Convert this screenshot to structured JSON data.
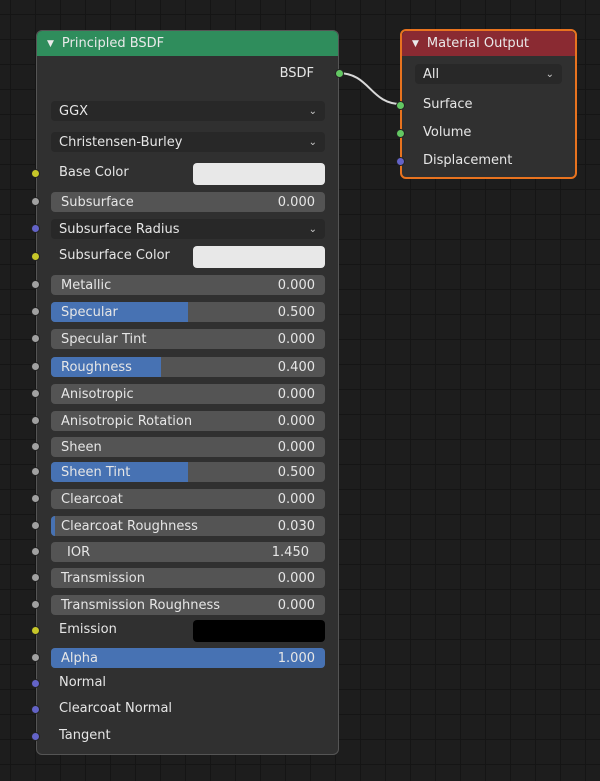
{
  "principled": {
    "title": "Principled BSDF",
    "header_color": "#2f8d5c",
    "output_label": "BSDF",
    "distribution": "GGX",
    "subsurface_method": "Christensen-Burley",
    "rows": [
      {
        "type": "color",
        "label": "Base Color",
        "color": "#e8e8e8",
        "socket": "#c7c729"
      },
      {
        "type": "slider",
        "label": "Subsurface",
        "value": "0.000",
        "fraction": 0,
        "socket": "#a1a1a1"
      },
      {
        "type": "dropdown",
        "label": "Subsurface Radius",
        "socket": "#6363c7"
      },
      {
        "type": "color",
        "label": "Subsurface Color",
        "color": "#e8e8e8",
        "socket": "#c7c729"
      },
      {
        "type": "slider",
        "label": "Metallic",
        "value": "0.000",
        "fraction": 0,
        "socket": "#a1a1a1"
      },
      {
        "type": "slider",
        "label": "Specular",
        "value": "0.500",
        "fraction": 0.5,
        "socket": "#a1a1a1"
      },
      {
        "type": "slider",
        "label": "Specular Tint",
        "value": "0.000",
        "fraction": 0,
        "socket": "#a1a1a1"
      },
      {
        "type": "slider",
        "label": "Roughness",
        "value": "0.400",
        "fraction": 0.4,
        "socket": "#a1a1a1"
      },
      {
        "type": "slider",
        "label": "Anisotropic",
        "value": "0.000",
        "fraction": 0,
        "socket": "#a1a1a1"
      },
      {
        "type": "slider",
        "label": "Anisotropic Rotation",
        "value": "0.000",
        "fraction": 0,
        "socket": "#a1a1a1"
      },
      {
        "type": "slider",
        "label": "Sheen",
        "value": "0.000",
        "fraction": 0,
        "socket": "#a1a1a1"
      },
      {
        "type": "slider",
        "label": "Sheen Tint",
        "value": "0.500",
        "fraction": 0.5,
        "socket": "#a1a1a1"
      },
      {
        "type": "slider",
        "label": "Clearcoat",
        "value": "0.000",
        "fraction": 0,
        "socket": "#a1a1a1"
      },
      {
        "type": "slider",
        "label": "Clearcoat Roughness",
        "value": "0.030",
        "fraction": 0.03,
        "socket": "#a1a1a1"
      },
      {
        "type": "number",
        "label": "IOR",
        "value": "1.450",
        "socket": "#a1a1a1"
      },
      {
        "type": "slider",
        "label": "Transmission",
        "value": "0.000",
        "fraction": 0,
        "socket": "#a1a1a1"
      },
      {
        "type": "slider",
        "label": "Transmission Roughness",
        "value": "0.000",
        "fraction": 0,
        "socket": "#a1a1a1"
      },
      {
        "type": "color",
        "label": "Emission",
        "color": "#000000",
        "socket": "#c7c729"
      },
      {
        "type": "slider",
        "label": "Alpha",
        "value": "1.000",
        "fraction": 1,
        "socket": "#a1a1a1"
      },
      {
        "type": "socket",
        "label": "Normal",
        "socket": "#6363c7"
      },
      {
        "type": "socket",
        "label": "Clearcoat Normal",
        "socket": "#6363c7"
      },
      {
        "type": "socket",
        "label": "Tangent",
        "socket": "#6363c7"
      }
    ]
  },
  "output": {
    "title": "Material Output",
    "header_color": "#8a2a32",
    "target": "All",
    "inputs": [
      {
        "label": "Surface",
        "socket": "#63c763"
      },
      {
        "label": "Volume",
        "socket": "#63c763"
      },
      {
        "label": "Displacement",
        "socket": "#6363c7"
      }
    ]
  }
}
